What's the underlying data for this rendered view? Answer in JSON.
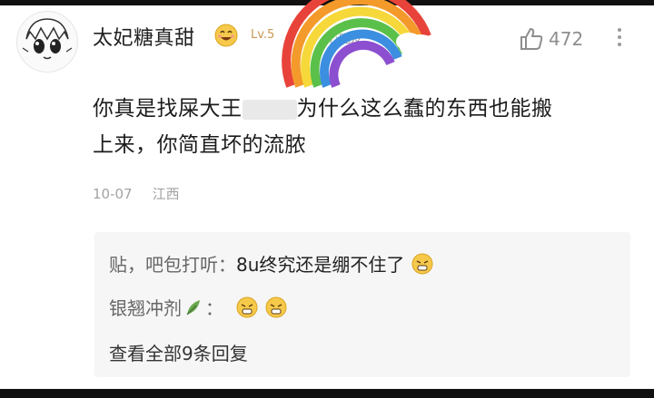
{
  "comment": {
    "username": "太妃糖真甜",
    "level": "Lv.5",
    "group": "心吧友",
    "likes": "472",
    "content": "你真是找屎大王🅰️🅱️为什么这么蠢的东西也能搬上来，你简直坏的流脓",
    "content_line1": "你真是找屎大王",
    "content_line1b": "为什么这么蠢的东西也能搬",
    "content_line2": "上来，你简直坏的流脓",
    "date": "10-07",
    "location": "江西"
  },
  "replies": [
    {
      "user": "贴，吧包打听",
      "separator": "：",
      "text": "8u终究还是绷不住了"
    },
    {
      "user": "银翘冲剂",
      "separator": "：",
      "text": ""
    }
  ],
  "view_all": "查看全部9条回复",
  "colors": {
    "accent": "#c79a52",
    "muted": "#a3a3a3",
    "reply_bg": "#f6f6f6"
  }
}
